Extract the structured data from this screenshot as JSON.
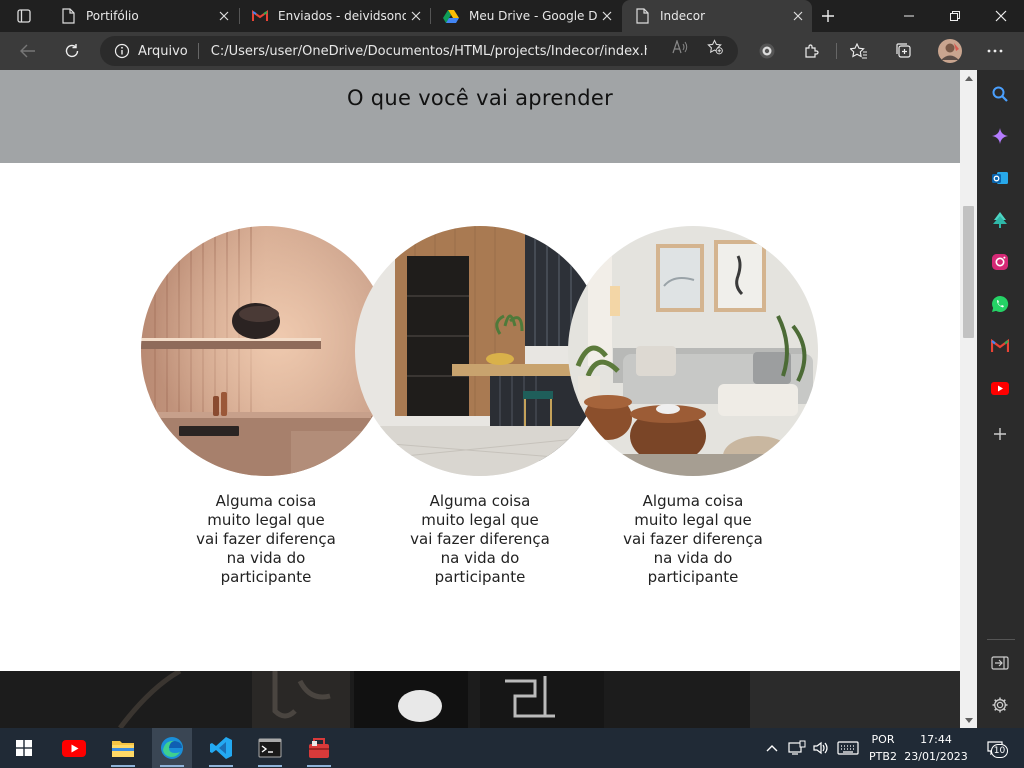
{
  "browser": {
    "tabs": [
      {
        "title": "Portifólio",
        "icon": "page-icon",
        "active": false
      },
      {
        "title": "Enviados - deividsonorr",
        "icon": "gmail-icon",
        "active": false
      },
      {
        "title": "Meu Drive - Google Driv",
        "icon": "google-drive-icon",
        "active": false
      },
      {
        "title": "Indecor",
        "icon": "page-icon",
        "active": true
      }
    ],
    "address": {
      "site_label": "Arquivo",
      "url": "C:/Users/user/OneDrive/Documentos/HTML/projects/Indecor/index.html"
    }
  },
  "page": {
    "section_title": "O que você vai aprender",
    "items": [
      {
        "caption": "Alguma coisa muito legal que vai fazer diferença na vida do participante"
      },
      {
        "caption": "Alguma coisa muito legal que vai fazer diferença na vida do participante"
      },
      {
        "caption": "Alguma coisa muito legal que vai fazer diferença na vida do participante"
      }
    ]
  },
  "taskbar": {
    "lang_top": "POR",
    "lang_bottom": "PTB2",
    "time": "17:44",
    "date": "23/01/2023",
    "notifications": "10"
  },
  "colors": {
    "hero_bg": "#a1a4a6",
    "browser_dark": "#202020",
    "toolbar": "#3b3b3b",
    "taskbar": "#202a36"
  }
}
